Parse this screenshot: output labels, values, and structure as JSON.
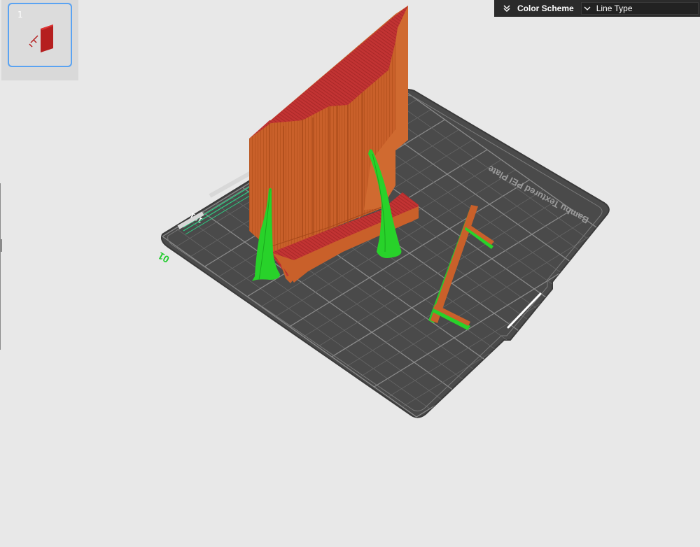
{
  "plate_list": {
    "plates": [
      {
        "number": "1",
        "selected": true
      }
    ]
  },
  "color_scheme": {
    "label": "Color Scheme",
    "value": "Line Type"
  },
  "build_plate": {
    "name": "Bambu Textured PEI Plate",
    "edge_marks": [
      "01",
      "101"
    ]
  },
  "colors": {
    "background": "#e8e8e8",
    "plate": "#4a4a4a",
    "grid": "#6b6b6b",
    "wall": "#c9602a",
    "top_surface": "#c23333",
    "support": "#28d22a",
    "accent": "#5aa3f2",
    "panel": "#2b2b2b"
  }
}
